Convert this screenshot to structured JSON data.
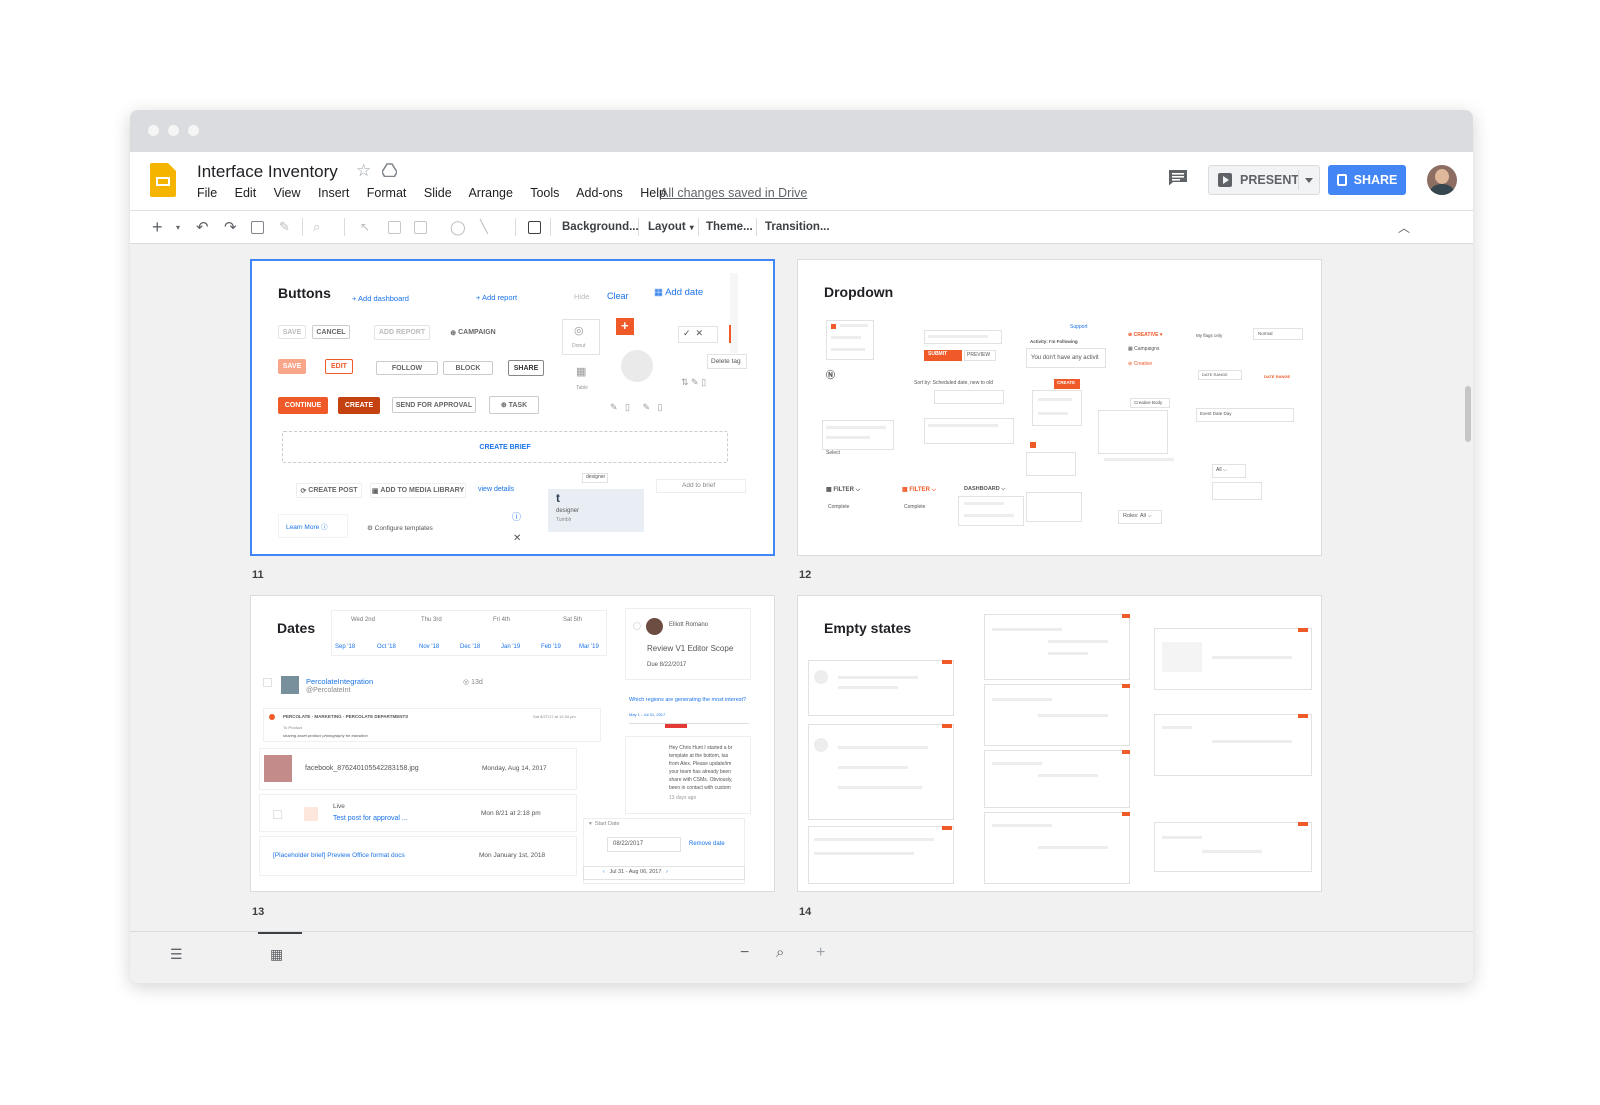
{
  "window": {
    "controls": [
      "close",
      "minimize",
      "maximize"
    ]
  },
  "app": {
    "title": "Interface Inventory",
    "menu": [
      "File",
      "Edit",
      "View",
      "Insert",
      "Format",
      "Slide",
      "Arrange",
      "Tools",
      "Add-ons",
      "Help"
    ],
    "save_status": "All changes saved in Drive",
    "present_label": "PRESENT",
    "share_label": "SHARE",
    "colors": {
      "share": "#4285f4",
      "logo": "#f4b400",
      "accent": "#f05a28",
      "selection": "#4285f4"
    }
  },
  "toolbar": {
    "background": "Background...",
    "layout": "Layout",
    "theme": "Theme...",
    "transition": "Transition..."
  },
  "slides": [
    {
      "number": "11",
      "title": "Buttons",
      "selected": true,
      "links": {
        "add_dashboard": "+ Add dashboard",
        "add_report": "+ Add report",
        "hide": "Hide",
        "clear": "Clear",
        "add_date": "Add date",
        "view_details": "view details",
        "learn_more": "Learn More",
        "configure": "Configure templates",
        "delete_tag": "Delete tag",
        "add_to_brief": "Add to brief",
        "donut": "Donut",
        "table": "Table",
        "tumblr_name": "designer",
        "tumblr_sub": "Tumblr"
      },
      "buttons": {
        "save": "SAVE",
        "cancel": "CANCEL",
        "add_report": "ADD REPORT",
        "campaign": "CAMPAIGN",
        "save2": "SAVE",
        "edit": "EDIT",
        "follow": "FOLLOW",
        "block": "BLOCK",
        "share": "SHARE",
        "continue": "CONTINUE",
        "create": "CREATE",
        "send": "SEND FOR APPROVAL",
        "task": "TASK",
        "create_brief": "CREATE BRIEF",
        "create_post": "CREATE POST",
        "add_media": "ADD TO MEDIA LIBRARY"
      }
    },
    {
      "number": "12",
      "title": "Dropdown",
      "texts": {
        "support": "Support",
        "creative": "CREATIVE",
        "campaigns": "Campaigns",
        "creative2": "Creative",
        "my_flags": "My flags only",
        "normal": "Normal",
        "submit": "SUBMIT",
        "preview": "PREVIEW",
        "activity": "Activity: I'm Following",
        "no_activity": "You don't have any activit",
        "create": "CREATE",
        "date_range": "DATE RANGE",
        "date_range2": "DATE RANGE",
        "sort_by": "Sort by: Scheduled date, new to old",
        "creative_body": "Creative Body",
        "event_date": "Event Date Day",
        "filter": "FILTER",
        "filter2": "FILTER",
        "dashboard": "DASHBOARD",
        "complete": "Complete",
        "complete2": "Complete",
        "roles": "Roles: All",
        "all": "All",
        "select": "Select"
      }
    },
    {
      "number": "13",
      "title": "Dates",
      "days": [
        "Wed 2nd",
        "Thu 3rd",
        "Fri 4th",
        "Sat 5th"
      ],
      "months": [
        "Sep '18",
        "Oct '18",
        "Nov '18",
        "Dec '18",
        "Jan '19",
        "Feb '19",
        "Mar '19"
      ],
      "rows": {
        "integration_name": "PercolateIntegration",
        "integration_handle": "@PercolateInt",
        "integration_time": "13d",
        "dept": "PERCOLATE · MARKETING · PERCOLATE DEPARTMENTS",
        "dept_date": "Sat 8/27/17 at 12:34 pm",
        "to_product": "To Product",
        "sharing": "sharing asset product photography for transition",
        "file_name": "facebook_876240105542283158.jpg",
        "file_date": "Monday, Aug 14, 2017",
        "live": "Live",
        "test_post": "Test post for approval ...",
        "test_date": "Mon 8/21 at 2:18 pm",
        "placeholder": "[Placeholder brief] Preview Office format docs",
        "placeholder_date": "Mon January 1st, 2018"
      },
      "card": {
        "person": "Elliott Romano",
        "task": "Review V1 Editor Scope",
        "due": "Due 8/22/2017",
        "question": "Which regions are generating the most interest?",
        "chart_caption": "May 1 - Jul 31, 2017",
        "message": [
          "Hey Chris Hunt I started a br",
          "template at the bottom, tas",
          "from Alex. Please update/im",
          "your team has already been",
          "share with CSMs. Obviously,",
          "been in contact with custom"
        ],
        "ago": "13 days ago"
      },
      "start_date": {
        "label": "Start Date",
        "value": "08/22/2017",
        "remove": "Remove date",
        "range": "Jul 31 - Aug 06, 2017"
      }
    },
    {
      "number": "14",
      "title": "Empty states"
    }
  ],
  "bottom": {
    "zoom_out": "−",
    "zoom_in": "+"
  }
}
